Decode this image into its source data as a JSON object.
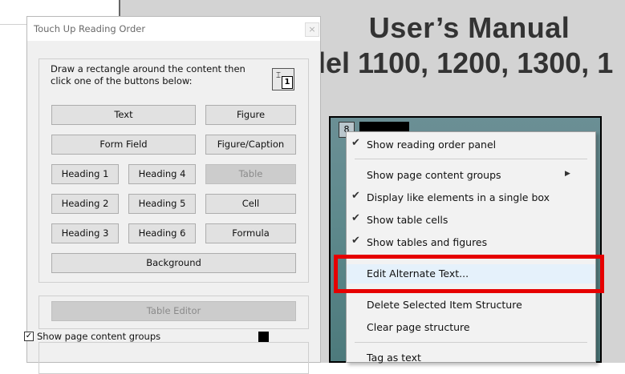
{
  "document": {
    "title": "User’s Manual",
    "subtitle": "lel 1100, 1200, 1300, 1",
    "figure_label": "8"
  },
  "dialog": {
    "title": "Touch Up Reading Order",
    "close_glyph": "×",
    "instructions": "Draw a rectangle around the content then click one of the buttons below:",
    "tool_icon_glyph": "⌶",
    "tool_icon_badge": "1",
    "buttons": {
      "text": "Text",
      "figure": "Figure",
      "form_field": "Form Field",
      "figure_caption": "Figure/Caption",
      "heading1": "Heading 1",
      "heading4": "Heading 4",
      "table": "Table",
      "heading2": "Heading 2",
      "heading5": "Heading 5",
      "cell": "Cell",
      "heading3": "Heading 3",
      "heading6": "Heading 6",
      "formula": "Formula",
      "background": "Background",
      "table_editor": "Table Editor"
    },
    "show_groups_label": "Show page content groups",
    "show_groups_checked": true,
    "checkmark": "✓",
    "swatch_color": "#000000"
  },
  "context_menu": {
    "check_glyph": "✔",
    "submenu_glyph": "▶",
    "items": [
      {
        "label": "Show reading order panel",
        "checked": true
      },
      {
        "label": "Show page content groups",
        "checked": false,
        "submenu": true
      },
      {
        "label": "Display like elements in a single box",
        "checked": true
      },
      {
        "label": "Show table cells",
        "checked": true
      },
      {
        "label": "Show tables and figures",
        "checked": true
      },
      {
        "label": "Edit Alternate Text...",
        "checked": false,
        "highlighted": true
      },
      {
        "label": "Delete Selected Item Structure",
        "checked": false
      },
      {
        "label": "Clear page structure",
        "checked": false
      },
      {
        "label": "Tag as text",
        "checked": false
      }
    ]
  },
  "colors": {
    "highlight_box": "#e60000",
    "document_bg": "#d3d3d3"
  }
}
